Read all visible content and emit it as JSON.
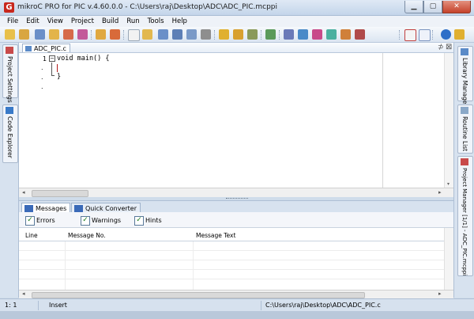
{
  "window": {
    "title": "mikroC PRO for PIC v.4.60.0.0 - C:\\Users\\raj\\Desktop\\ADC\\ADC_PIC.mcppi",
    "app_icon_letter": "G",
    "minimize": "▁",
    "maximize": "▢",
    "close": "✕"
  },
  "menu": [
    "File",
    "Edit",
    "View",
    "Project",
    "Build",
    "Run",
    "Tools",
    "Help"
  ],
  "left_tabs": [
    "Project Settings",
    "Code Explorer"
  ],
  "right_tabs": [
    "Library Manager",
    "Routine List",
    "Project Manager [1/1] - ADC_PIC.mcppi"
  ],
  "editor": {
    "tab_label": "ADC_PIC.c",
    "pin_glyph": "⊅",
    "close_glyph": "⊠",
    "lines": [
      {
        "num": "1",
        "text": "void main() {"
      },
      {
        "num": ".",
        "text": ""
      },
      {
        "num": ".",
        "text": "}"
      },
      {
        "num": ".",
        "text": ""
      }
    ]
  },
  "messages": {
    "tabs": [
      "Messages",
      "Quick Converter"
    ],
    "filters": [
      {
        "label": "Errors",
        "checked": true
      },
      {
        "label": "Warnings",
        "checked": true
      },
      {
        "label": "Hints",
        "checked": true
      }
    ],
    "columns": [
      "Line",
      "Message No.",
      "Message Text"
    ]
  },
  "status": {
    "position": "1: 1",
    "mode": "Insert",
    "path": "C:\\Users\\raj\\Desktop\\ADC\\ADC_PIC.c"
  }
}
